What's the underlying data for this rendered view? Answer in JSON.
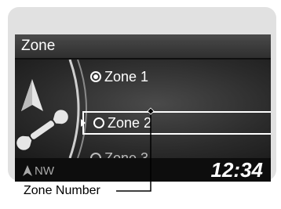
{
  "screen": {
    "title": "Zone",
    "options": [
      {
        "label": "Zone 1",
        "selected": true
      },
      {
        "label": "Zone 2",
        "selected": false,
        "highlighted": true
      },
      {
        "label": "Zone 3",
        "selected": false
      }
    ],
    "status": {
      "heading": "NW",
      "clock": "12:34"
    }
  },
  "callout": {
    "label": "Zone Number"
  },
  "icons": {
    "menu_icon": "navigation-arrow-wrench-icon",
    "compass_icon": "compass-arrow-icon"
  }
}
